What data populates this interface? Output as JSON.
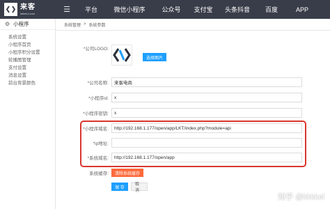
{
  "brand": {
    "mark": "⌒",
    "name": "来客",
    "domain": "laiketui.com"
  },
  "nav": [
    "平台",
    "微信小程序",
    "公众号",
    "支付宝",
    "头条抖音",
    "百度",
    "APP"
  ],
  "sidebar": {
    "title": "小程序",
    "items": [
      "系统设置",
      "小程序首页",
      "小程序积分设置",
      "轮播图管理",
      "支付设置",
      "消息设置",
      "前台背景颜色"
    ]
  },
  "breadcrumb": {
    "parent": "系统管理",
    "separator": ">",
    "current": "系统参数"
  },
  "form": {
    "logo_label": "*公司LOGO:",
    "choose_image": "选择图片",
    "company_name_label": "*公司名称:",
    "company_name_value": "来客电商",
    "appid_label": "*小程序id:",
    "appid_value": "x",
    "secret_label": "*小程序密钥:",
    "secret_value": "x",
    "domain_label": "*小程序域名:",
    "domain_value": "http://192.168.1.177/open/app/LKT/index.php?module=api",
    "ip_label": "*ip地址:",
    "ip_value": "",
    "system_domain_label": "*系统域名:",
    "system_domain_value": "http://192.168.1.177/open/app",
    "cache_label": "系统缓存:",
    "clear_cache": "清除系统缓存",
    "save": "保 存",
    "cancel": "取 消"
  },
  "watermark": "知乎 @kkkkol"
}
